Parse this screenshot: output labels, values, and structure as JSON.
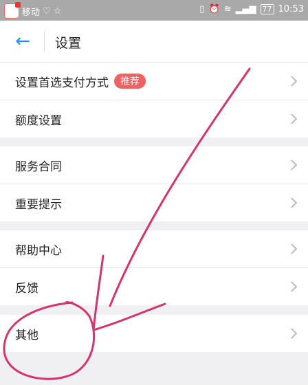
{
  "status_bar": {
    "carrier": "移动",
    "time": "10:53",
    "battery": "77"
  },
  "header": {
    "title": "设置"
  },
  "groups": [
    {
      "items": [
        {
          "label": "设置首选支付方式",
          "badge": "推荐"
        },
        {
          "label": "额度设置"
        }
      ]
    },
    {
      "items": [
        {
          "label": "服务合同"
        },
        {
          "label": "重要提示"
        }
      ]
    },
    {
      "items": [
        {
          "label": "帮助中心"
        },
        {
          "label": "反馈"
        }
      ]
    },
    {
      "items": [
        {
          "label": "其他"
        }
      ]
    }
  ],
  "annotation": {
    "stroke_color": "#d6336c"
  }
}
